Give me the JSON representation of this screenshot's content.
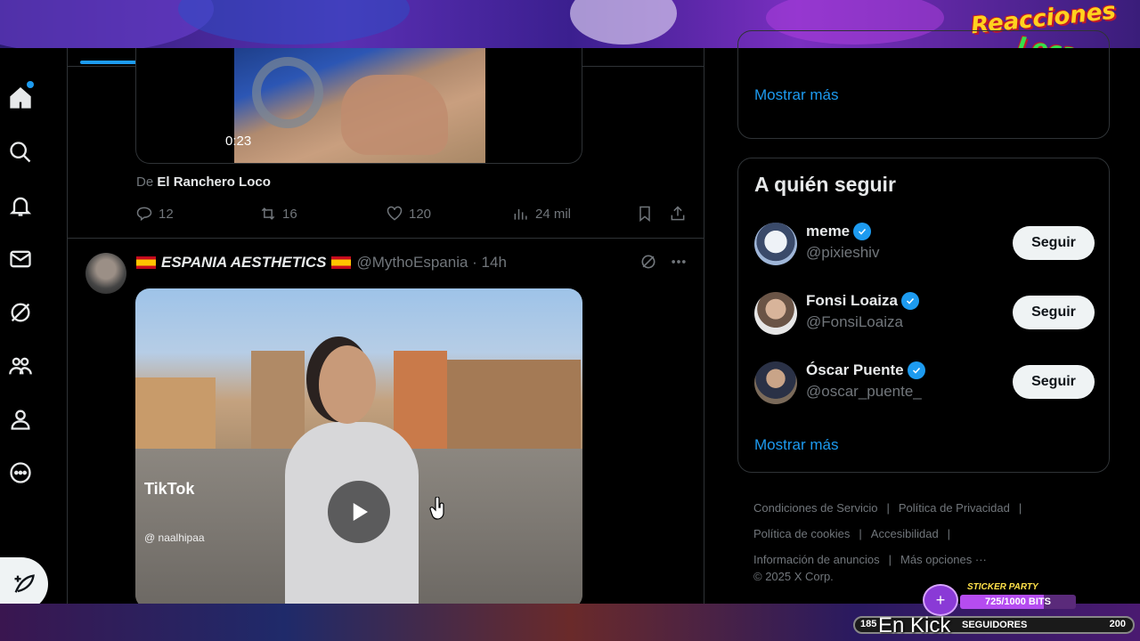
{
  "overlay": {
    "logo_line1": "Reacciones",
    "logo_line2": "Locas",
    "sticker_title": "STICKER PARTY",
    "sticker_progress": "725/1000 BITS",
    "sticker_fraction": 0.725,
    "followers_current": "185",
    "followers_label": "SEGUIDORES",
    "followers_goal": "200",
    "kick_text": "En Kick"
  },
  "sidebar": {
    "items": [
      "home-icon",
      "search-icon",
      "notifications-icon",
      "messages-icon",
      "grok-icon",
      "communities-icon",
      "profile-icon",
      "more-icon"
    ],
    "compose": "compose-icon"
  },
  "feed": {
    "tweet1": {
      "duration": "0:23",
      "source_prefix": "De",
      "source_name": "El Ranchero Loco",
      "replies": "12",
      "retweets": "16",
      "likes": "120",
      "views": "24 mil"
    },
    "tweet2": {
      "display_name": "ESPANIA AESTHETICS",
      "handle": "@MythoEspania · 14h",
      "watermark": "TikTok",
      "watermark_handle": "@ naalhipaa"
    }
  },
  "right": {
    "show_more_top": "Mostrar más",
    "who_title": "A quién seguir",
    "suggestions": [
      {
        "name": "meme",
        "handle": "@pixieshiv",
        "button": "Seguir"
      },
      {
        "name": "Fonsi Loaiza",
        "handle": "@FonsiLoaiza",
        "button": "Seguir"
      },
      {
        "name": "Óscar Puente",
        "handle": "@oscar_puente_",
        "button": "Seguir"
      }
    ],
    "show_more": "Mostrar más",
    "footer": {
      "terms": "Condiciones de Servicio",
      "privacy": "Política de Privacidad",
      "cookies": "Política de cookies",
      "accessibility": "Accesibilidad",
      "ads_info": "Información de anuncios",
      "more": "Más opciones ···",
      "copyright": "© 2025 X Corp."
    }
  }
}
